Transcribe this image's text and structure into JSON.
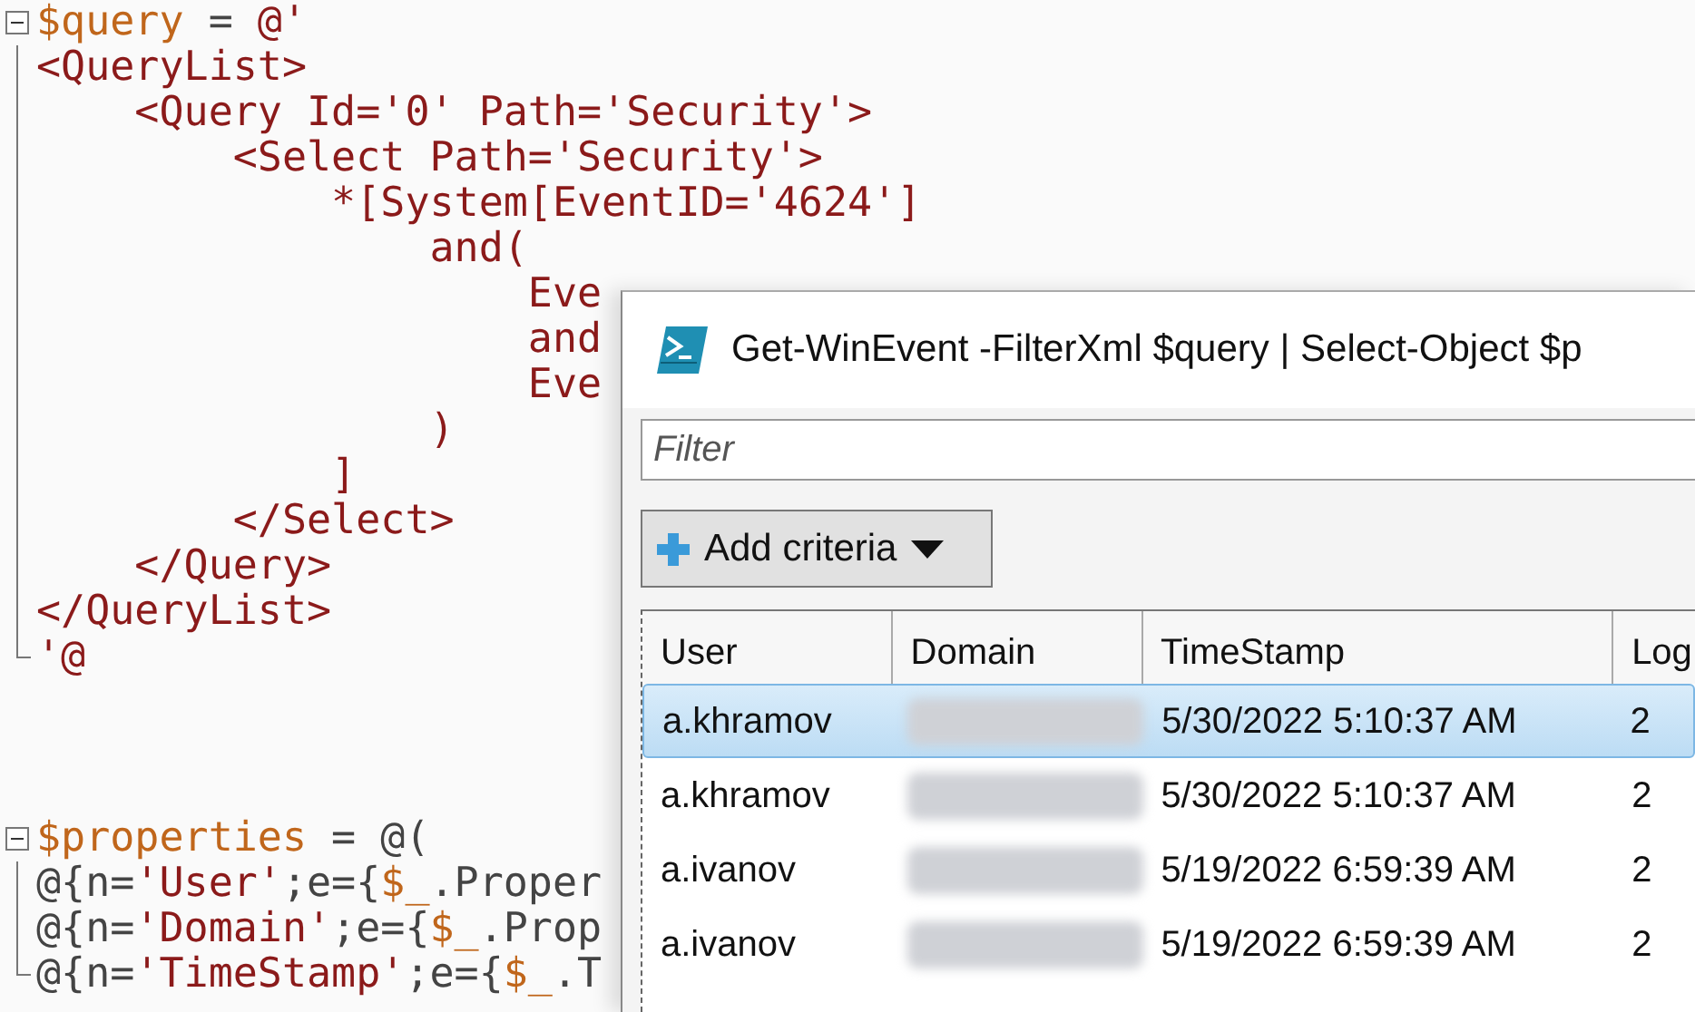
{
  "editor": {
    "lines": [
      {
        "kind": "fold",
        "expanded": true,
        "segments": [
          {
            "text": "$query",
            "kind": "var"
          },
          {
            "text": " = ",
            "kind": "op"
          },
          {
            "text": "@'",
            "kind": "xml"
          }
        ]
      },
      {
        "kind": "code",
        "segments": [
          {
            "text": "<QueryList>",
            "kind": "xml"
          }
        ]
      },
      {
        "kind": "code",
        "segments": [
          {
            "text": "    <Query Id='0' Path='Security'>",
            "kind": "xml"
          }
        ]
      },
      {
        "kind": "code",
        "segments": [
          {
            "text": "        <Select Path='Security'>",
            "kind": "xml"
          }
        ]
      },
      {
        "kind": "code",
        "segments": [
          {
            "text": "            *[System[EventID='4624']",
            "kind": "xml"
          }
        ]
      },
      {
        "kind": "code",
        "segments": [
          {
            "text": "                and(",
            "kind": "xml"
          }
        ]
      },
      {
        "kind": "code",
        "segments": [
          {
            "text": "                    Eve",
            "kind": "xml"
          }
        ]
      },
      {
        "kind": "code",
        "segments": [
          {
            "text": "                    and",
            "kind": "xml"
          }
        ]
      },
      {
        "kind": "code",
        "segments": [
          {
            "text": "                    Eve",
            "kind": "xml"
          }
        ]
      },
      {
        "kind": "code",
        "segments": [
          {
            "text": "                )",
            "kind": "xml"
          }
        ]
      },
      {
        "kind": "code",
        "segments": [
          {
            "text": "            ]",
            "kind": "xml"
          }
        ]
      },
      {
        "kind": "code",
        "segments": [
          {
            "text": "        </Select>",
            "kind": "xml"
          }
        ]
      },
      {
        "kind": "code",
        "segments": [
          {
            "text": "    </Query>",
            "kind": "xml"
          }
        ]
      },
      {
        "kind": "code",
        "segments": [
          {
            "text": "</QueryList>",
            "kind": "xml"
          }
        ]
      },
      {
        "kind": "code",
        "segments": [
          {
            "text": "'@",
            "kind": "xml"
          }
        ]
      },
      {
        "kind": "blank"
      },
      {
        "kind": "blank"
      },
      {
        "kind": "blank"
      },
      {
        "kind": "fold",
        "expanded": true,
        "segments": [
          {
            "text": "$properties",
            "kind": "var"
          },
          {
            "text": " = @(",
            "kind": "op"
          }
        ]
      },
      {
        "kind": "code",
        "segments": [
          {
            "text": "@{n=",
            "kind": "op"
          },
          {
            "text": "'User'",
            "kind": "xml"
          },
          {
            "text": ";e={",
            "kind": "op"
          },
          {
            "text": "$_",
            "kind": "var"
          },
          {
            "text": ".Proper",
            "kind": "op"
          }
        ]
      },
      {
        "kind": "code",
        "segments": [
          {
            "text": "@{n=",
            "kind": "op"
          },
          {
            "text": "'Domain'",
            "kind": "xml"
          },
          {
            "text": ";e={",
            "kind": "op"
          },
          {
            "text": "$_",
            "kind": "var"
          },
          {
            "text": ".Prop",
            "kind": "op"
          }
        ]
      },
      {
        "kind": "code",
        "segments": [
          {
            "text": "@{n=",
            "kind": "op"
          },
          {
            "text": "'TimeStamp'",
            "kind": "xml"
          },
          {
            "text": ";e={",
            "kind": "op"
          },
          {
            "text": "$_",
            "kind": "var"
          },
          {
            "text": ".T",
            "kind": "op"
          }
        ]
      }
    ]
  },
  "window": {
    "title": "Get-WinEvent -FilterXml $query |  Select-Object $p",
    "filter": {
      "placeholder": "Filter"
    },
    "add_criteria": {
      "label": "Add criteria"
    },
    "table": {
      "columns": [
        "User",
        "Domain",
        "TimeStamp",
        "Log"
      ],
      "rows": [
        {
          "user": "a.khramov",
          "timestamp": "5/30/2022 5:10:37 AM",
          "log": "2",
          "selected": true
        },
        {
          "user": "a.khramov",
          "timestamp": "5/30/2022 5:10:37 AM",
          "log": "2",
          "selected": false
        },
        {
          "user": "a.ivanov",
          "timestamp": "5/19/2022 6:59:39 AM",
          "log": "2",
          "selected": false
        },
        {
          "user": "a.ivanov",
          "timestamp": "5/19/2022 6:59:39 AM",
          "log": "2",
          "selected": false
        }
      ]
    }
  }
}
